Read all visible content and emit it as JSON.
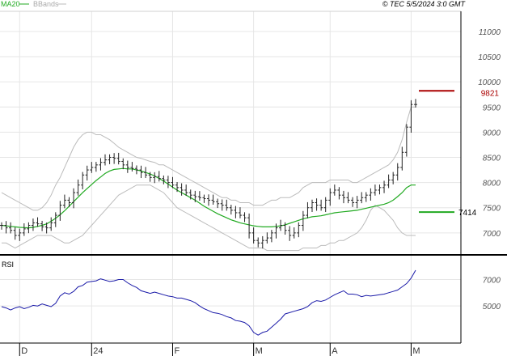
{
  "header": {
    "ma20_label": "MA20",
    "bbands_label": "BBands",
    "timestamp": "© TEC 5/5/2024 3:0 GMT"
  },
  "colors": {
    "price": "#222222",
    "ma20": "#22aa22",
    "bbands": "#bbbbbb",
    "rsi": "#1a1aa8",
    "resistance": "#aa0000",
    "support": "#22aa22",
    "grid": "#e6e6e6"
  },
  "chart_data": [
    {
      "type": "line",
      "panel": "price",
      "render": "ohlc-bars",
      "y_ticks": [
        7000,
        7500,
        8000,
        8500,
        9000,
        9500,
        10000,
        10500,
        11000
      ],
      "y_tick_labels": [
        "7000",
        "7500",
        "8000",
        "8500",
        "9000",
        "9500",
        "10000",
        "10500",
        "11000"
      ],
      "ylim": [
        6580,
        11400
      ],
      "x_ticks": [
        {
          "index": 4,
          "label": "D"
        },
        {
          "index": 20,
          "label": "24"
        },
        {
          "index": 38,
          "label": "F"
        },
        {
          "index": 56,
          "label": "M"
        },
        {
          "index": 73,
          "label": "A"
        },
        {
          "index": 91,
          "label": "M"
        }
      ],
      "num_sessions": 93,
      "close": [
        7150,
        7100,
        7050,
        6950,
        7000,
        7080,
        7150,
        7200,
        7180,
        7120,
        7100,
        7200,
        7350,
        7550,
        7650,
        7600,
        7800,
        7950,
        8150,
        8250,
        8300,
        8350,
        8400,
        8450,
        8500,
        8480,
        8420,
        8350,
        8300,
        8280,
        8250,
        8200,
        8150,
        8100,
        8120,
        8080,
        8050,
        8000,
        7950,
        7900,
        7850,
        7800,
        7750,
        7720,
        7700,
        7680,
        7650,
        7620,
        7580,
        7550,
        7500,
        7450,
        7400,
        7350,
        7300,
        7000,
        6850,
        6800,
        6850,
        6900,
        7000,
        7100,
        7150,
        7050,
        6950,
        7000,
        7150,
        7350,
        7500,
        7600,
        7550,
        7500,
        7650,
        7800,
        7850,
        7750,
        7700,
        7650,
        7600,
        7650,
        7700,
        7750,
        7800,
        7850,
        7900,
        7950,
        8050,
        8150,
        8300,
        8600,
        9100,
        9550,
        9550
      ],
      "ma20": [
        7150,
        7140,
        7130,
        7120,
        7110,
        7105,
        7100,
        7110,
        7130,
        7150,
        7180,
        7230,
        7290,
        7360,
        7440,
        7530,
        7620,
        7710,
        7800,
        7880,
        7960,
        8040,
        8110,
        8180,
        8230,
        8260,
        8270,
        8280,
        8270,
        8270,
        8250,
        8230,
        8200,
        8170,
        8130,
        8080,
        8030,
        7970,
        7910,
        7850,
        7800,
        7750,
        7700,
        7650,
        7590,
        7530,
        7480,
        7430,
        7380,
        7340,
        7300,
        7260,
        7230,
        7200,
        7180,
        7160,
        7140,
        7130,
        7120,
        7120,
        7120,
        7130,
        7140,
        7160,
        7190,
        7220,
        7250,
        7280,
        7300,
        7320,
        7330,
        7340,
        7360,
        7380,
        7400,
        7410,
        7420,
        7430,
        7440,
        7450,
        7470,
        7490,
        7510,
        7530,
        7550,
        7570,
        7600,
        7650,
        7720,
        7800,
        7900,
        7950,
        7950
      ],
      "bb_upper": [
        7800,
        7750,
        7700,
        7650,
        7600,
        7550,
        7500,
        7450,
        7450,
        7500,
        7600,
        7750,
        7950,
        8100,
        8300,
        8500,
        8700,
        8850,
        8950,
        9000,
        9000,
        8950,
        8950,
        8900,
        8850,
        8780,
        8700,
        8650,
        8600,
        8550,
        8500,
        8480,
        8450,
        8420,
        8400,
        8350,
        8350,
        8300,
        8250,
        8200,
        8150,
        8100,
        8050,
        8000,
        7950,
        7900,
        7850,
        7800,
        7750,
        7700,
        7700,
        7650,
        7650,
        7600,
        7600,
        7600,
        7550,
        7550,
        7550,
        7600,
        7650,
        7650,
        7700,
        7700,
        7700,
        7750,
        7800,
        7900,
        7950,
        8000,
        8000,
        8000,
        8000,
        8050,
        8050,
        8050,
        8050,
        8050,
        8000,
        8000,
        8050,
        8100,
        8150,
        8200,
        8250,
        8300,
        8350,
        8450,
        8600,
        8850,
        9200,
        9500,
        9500
      ],
      "bb_lower": [
        6800,
        6800,
        6750,
        6700,
        6750,
        6800,
        6850,
        6900,
        6950,
        6950,
        6950,
        6950,
        6900,
        6850,
        6800,
        6800,
        6850,
        6900,
        6950,
        7050,
        7150,
        7250,
        7350,
        7450,
        7550,
        7650,
        7750,
        7800,
        7850,
        7900,
        7950,
        7950,
        7950,
        7950,
        7900,
        7850,
        7800,
        7700,
        7600,
        7500,
        7450,
        7400,
        7350,
        7300,
        7250,
        7200,
        7150,
        7100,
        7050,
        7000,
        6950,
        6900,
        6850,
        6800,
        6750,
        6700,
        6700,
        6700,
        6700,
        6650,
        6650,
        6650,
        6650,
        6650,
        6650,
        6650,
        6650,
        6700,
        6700,
        6700,
        6700,
        6750,
        6750,
        6800,
        6800,
        6850,
        6850,
        6900,
        6950,
        7000,
        7100,
        7250,
        7450,
        7550,
        7500,
        7450,
        7350,
        7250,
        7100,
        7000,
        6950,
        6950,
        6950
      ],
      "resistance": {
        "value": 9821,
        "label": "9821",
        "start_index": 88
      },
      "support": {
        "value": 7414,
        "label": "7414",
        "start_index": 88
      }
    },
    {
      "type": "line",
      "panel": "rsi",
      "title": "RSI",
      "y_ticks": [
        5000,
        7000
      ],
      "y_tick_labels": [
        "5000",
        "7000"
      ],
      "ylim": [
        2200,
        8800
      ],
      "values": [
        4950,
        4850,
        4700,
        4850,
        4950,
        4800,
        4900,
        5050,
        5000,
        5150,
        5050,
        4950,
        5200,
        5750,
        6000,
        5900,
        6100,
        6450,
        6550,
        6800,
        6850,
        6900,
        7050,
        6950,
        6850,
        6900,
        7000,
        7000,
        6750,
        6550,
        6400,
        6150,
        6050,
        5950,
        6050,
        5950,
        5850,
        5750,
        5700,
        5600,
        5600,
        5500,
        5400,
        5250,
        5000,
        4800,
        4650,
        4500,
        4450,
        4350,
        4200,
        4100,
        3900,
        3850,
        3750,
        3500,
        3000,
        2800,
        3000,
        3100,
        3400,
        3700,
        4000,
        4400,
        4500,
        4600,
        4700,
        4800,
        4950,
        5250,
        5400,
        5350,
        5450,
        5650,
        5850,
        6000,
        6150,
        5900,
        5900,
        5850,
        5700,
        5800,
        5750,
        5800,
        5850,
        5900,
        6000,
        6100,
        6200,
        6450,
        6700,
        7100,
        7700
      ]
    }
  ]
}
